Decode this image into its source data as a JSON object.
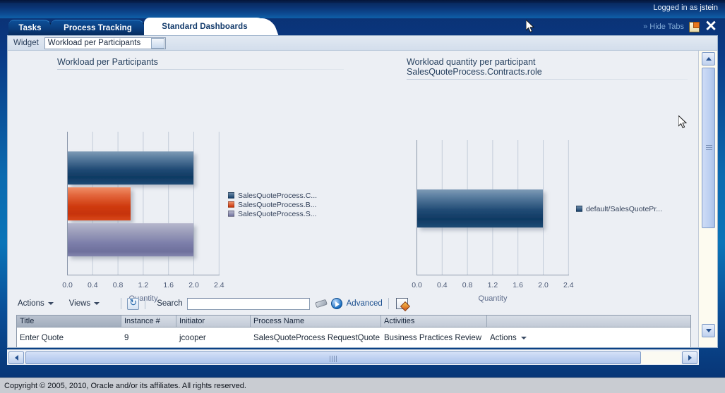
{
  "header": {
    "logged_in_prefix": "Logged in as",
    "user": "jstein",
    "hide_tabs": "Hide Tabs",
    "hide_tabs_chevron": "»",
    "note_icon": "sticky-note-icon",
    "close_icon": "close-icon"
  },
  "tabs": [
    {
      "label": "Tasks",
      "active": false
    },
    {
      "label": "Process Tracking",
      "active": false
    },
    {
      "label": "Standard Dashboards",
      "active": true
    }
  ],
  "widget_bar": {
    "label": "Widget",
    "selected": "Workload per Participants",
    "dropdown_icon": "chevron-down-icon"
  },
  "chart_data": [
    {
      "type": "bar",
      "orientation": "horizontal",
      "title": "Workload per Participants",
      "xlabel": "Quantity",
      "ylabel": "",
      "xlim": [
        0,
        2.4
      ],
      "xticks": [
        "0.0",
        "0.4",
        "0.8",
        "1.2",
        "1.6",
        "2.0",
        "2.4"
      ],
      "grid": true,
      "legend_position": "right",
      "categories": [
        "SalesQuoteProcess.C...",
        "SalesQuoteProcess.B...",
        "SalesQuoteProcess.S..."
      ],
      "values": [
        2.0,
        1.0,
        2.0
      ],
      "colors": [
        "#1c4b79",
        "#d44218",
        "#7d7fae"
      ],
      "legend": [
        {
          "label": "SalesQuoteProcess.C...",
          "color": "#1c4b79"
        },
        {
          "label": "SalesQuoteProcess.B...",
          "color": "#d44218"
        },
        {
          "label": "SalesQuoteProcess.S...",
          "color": "#7d7fae"
        }
      ]
    },
    {
      "type": "bar",
      "orientation": "horizontal",
      "title": "Workload quantity per participant\nSalesQuoteProcess.Contracts.role",
      "xlabel": "Quantity",
      "ylabel": "",
      "xlim": [
        0,
        2.4
      ],
      "xticks": [
        "0.0",
        "0.4",
        "0.8",
        "1.2",
        "1.6",
        "2.0",
        "2.4"
      ],
      "grid": true,
      "legend_position": "right",
      "categories": [
        "default/SalesQuotePr..."
      ],
      "values": [
        2.0
      ],
      "colors": [
        "#1c4b79"
      ],
      "legend": [
        {
          "label": "default/SalesQuotePr...",
          "color": "#1c4b79"
        }
      ]
    }
  ],
  "toolbar": {
    "actions_label": "Actions",
    "views_label": "Views",
    "refresh_icon": "refresh-icon",
    "search_label": "Search",
    "search_value": "",
    "search_placeholder": "",
    "erase_icon": "eraser-icon",
    "go_icon": "go-play-icon",
    "advanced_label": "Advanced",
    "query_icon": "saved-query-icon"
  },
  "table": {
    "columns": [
      "Title",
      "Instance #",
      "Initiator",
      "Process Name",
      "Activities",
      ""
    ],
    "rows": [
      {
        "title": "Enter Quote",
        "instance": "9",
        "initiator": "jcooper",
        "process_name": "SalesQuoteProcess RequestQuote",
        "activities": "Business Practices Review",
        "actions_label": "Actions"
      }
    ]
  },
  "scrollbars": {
    "vertical_up_icon": "chevron-up-icon",
    "vertical_down_icon": "chevron-down-icon",
    "horizontal_left_icon": "chevron-left-icon",
    "horizontal_right_icon": "chevron-right-icon"
  },
  "footer": {
    "copyright": "Copyright © 2005, 2010, Oracle and/or its affiliates. All rights reserved."
  }
}
